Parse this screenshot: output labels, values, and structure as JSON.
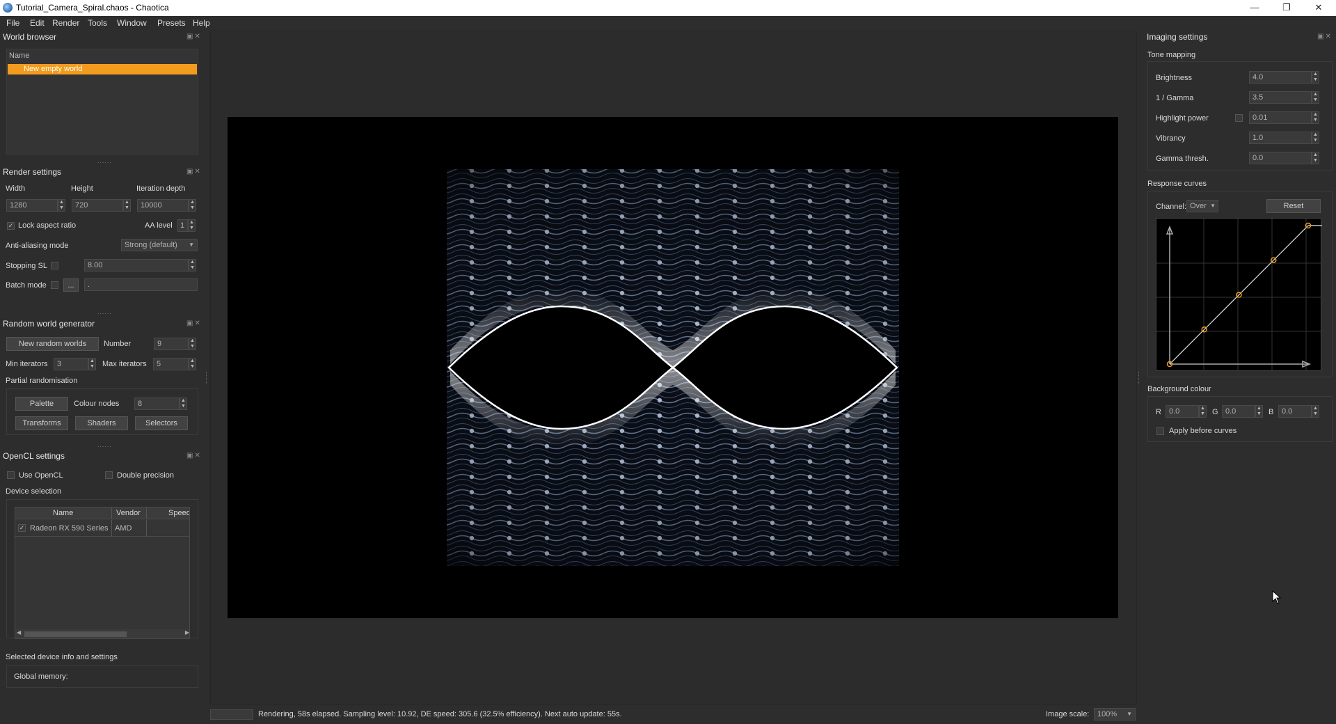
{
  "window": {
    "title": "Tutorial_Camera_Spiral.chaos - Chaotica"
  },
  "menu": [
    "File",
    "Edit",
    "Render",
    "Tools",
    "Window",
    "Presets",
    "Help"
  ],
  "world_browser": {
    "title": "World browser",
    "column_header": "Name",
    "items": [
      "New empty world"
    ]
  },
  "render_settings": {
    "title": "Render settings",
    "width_label": "Width",
    "height_label": "Height",
    "iter_label": "Iteration depth",
    "width": "1280",
    "height": "720",
    "iteration_depth": "10000",
    "lock_aspect_label": "Lock aspect ratio",
    "lock_aspect_checked": "✓",
    "aa_level_label": "AA level",
    "aa_level": "1",
    "aa_mode_label": "Anti-aliasing mode",
    "aa_mode": "Strong (default)",
    "stopping_sl_label": "Stopping SL",
    "stopping_sl": "8.00",
    "batch_mode_label": "Batch mode",
    "batch_browse": "...",
    "batch_path": "."
  },
  "random_world_generator": {
    "title": "Random world generator",
    "new_worlds_button": "New random worlds",
    "number_label": "Number",
    "number": "9",
    "min_iter_label": "Min iterators",
    "min_iter": "3",
    "max_iter_label": "Max iterators",
    "max_iter": "5",
    "partial_label": "Partial randomisation",
    "palette_button": "Palette",
    "colour_nodes_label": "Colour nodes",
    "colour_nodes": "8",
    "transforms_button": "Transforms",
    "shaders_button": "Shaders",
    "selectors_button": "Selectors"
  },
  "opencl": {
    "title": "OpenCL settings",
    "use_opencl_label": "Use OpenCL",
    "double_precision_label": "Double precision",
    "device_selection_label": "Device selection",
    "columns": [
      "Name",
      "Vendor",
      "Speed"
    ],
    "devices": [
      {
        "check": "✓",
        "name": "Radeon RX 590 Series",
        "vendor": "AMD",
        "speed": ""
      }
    ],
    "selected_info_label": "Selected device info and settings",
    "global_memory_label": "Global memory:"
  },
  "imaging": {
    "title": "Imaging settings",
    "tone_mapping_label": "Tone mapping",
    "brightness_label": "Brightness",
    "brightness": "4.0",
    "gamma_label": "1 / Gamma",
    "gamma": "3.5",
    "highlight_label": "Highlight power",
    "highlight": "0.01",
    "vibrancy_label": "Vibrancy",
    "vibrancy": "1.0",
    "gamma_thresh_label": "Gamma thresh.",
    "gamma_thresh": "0.0",
    "response_curves_label": "Response curves",
    "channel_label": "Channel:",
    "channel": "Over",
    "reset_button": "Reset",
    "curve_points": [
      [
        0,
        0
      ],
      [
        0.25,
        0.25
      ],
      [
        0.5,
        0.5
      ],
      [
        0.75,
        0.75
      ],
      [
        1,
        1
      ]
    ],
    "background_label": "Background colour",
    "r_label": "R",
    "r": "0.0",
    "g_label": "G",
    "g": "0.0",
    "b_label": "B",
    "b": "0.0",
    "apply_before_label": "Apply before curves"
  },
  "status": {
    "text": "Rendering, 58s elapsed. Sampling level: 10.92, DE speed: 305.6 (32.5% efficiency). Next auto update: 55s.",
    "image_scale_label": "Image scale:",
    "image_scale": "100%"
  },
  "colors": {
    "accent": "#f0a020",
    "selection": "#f29b1d",
    "bg": "#2d2d2d"
  }
}
